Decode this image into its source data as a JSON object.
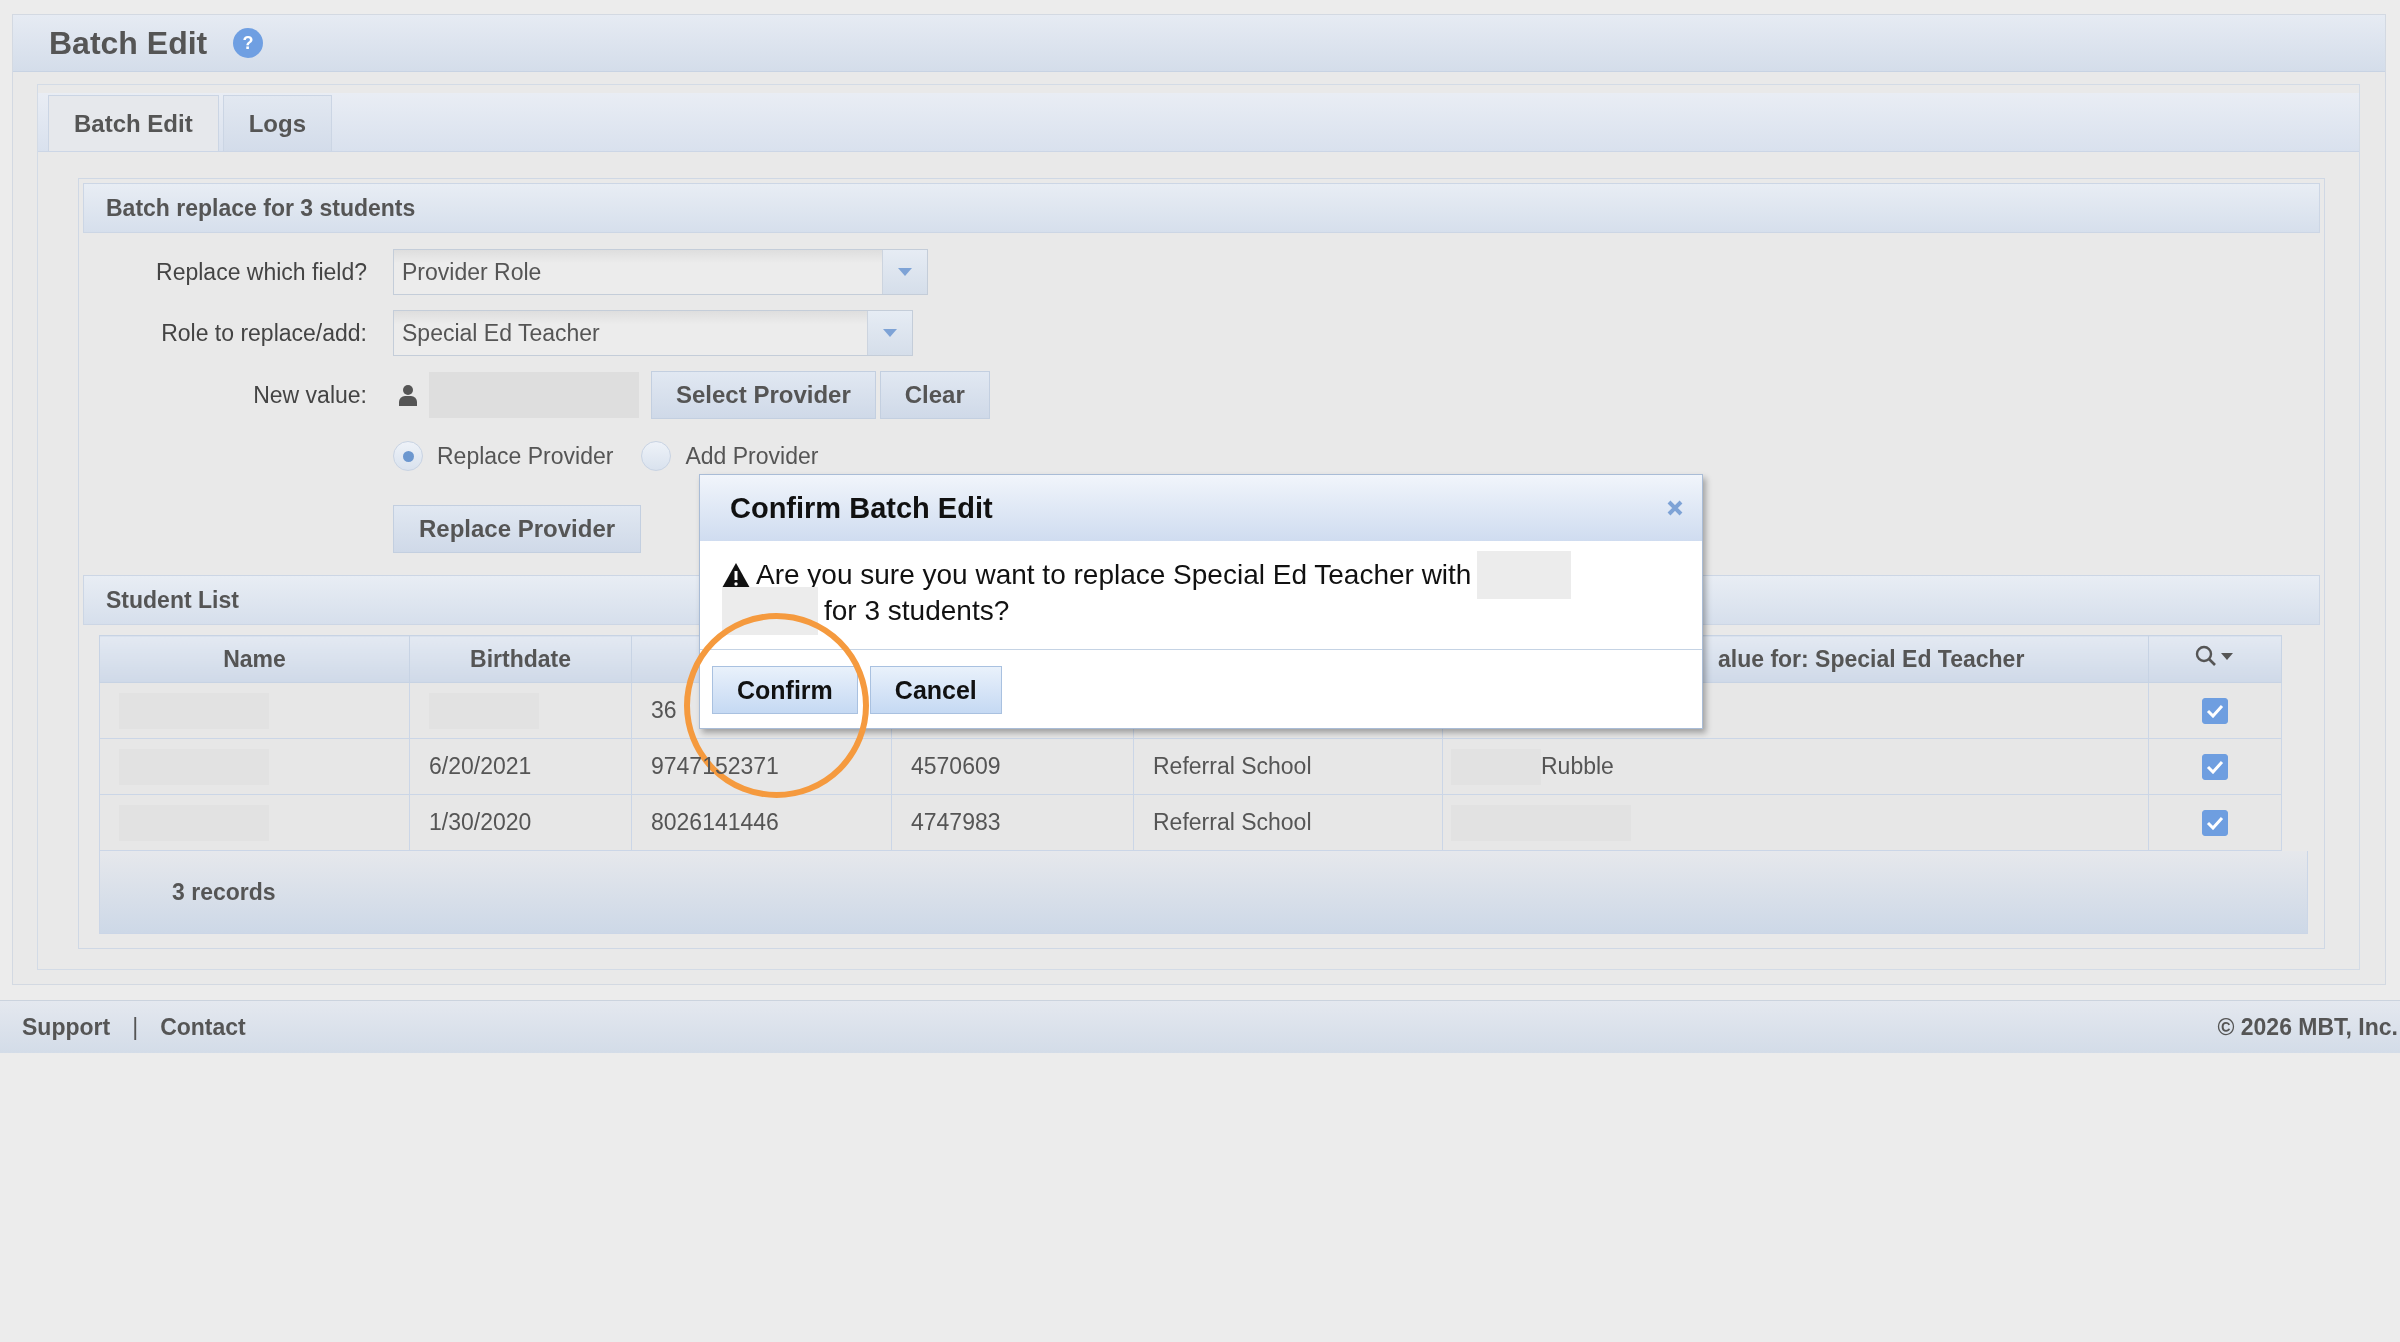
{
  "page_title": "Batch Edit",
  "help_icon": "?",
  "tabs": [
    {
      "label": "Batch Edit",
      "selected": true
    },
    {
      "label": "Logs",
      "selected": false
    }
  ],
  "batch_section": {
    "title": "Batch replace for 3 students",
    "fields": [
      {
        "label": "Replace which field?",
        "value": "Provider Role"
      },
      {
        "label": "Role to replace/add:",
        "value": "Special Ed Teacher"
      }
    ],
    "new_value_label": "New value:",
    "buttons": [
      "Select Provider",
      "Clear"
    ],
    "modes": [
      {
        "label": "Replace Provider",
        "selected": true
      },
      {
        "label": "Add Provider",
        "selected": false
      }
    ],
    "submit": "Replace Provider"
  },
  "student_list": {
    "title": "Student List",
    "columns": {
      "column_1": "Name",
      "column_2": "Birthdate",
      "column_6": "alue for: Special Ed Teacher"
    },
    "rows": [
      {
        "column_3": "36",
        "checked": true
      },
      {
        "birthdate": "6/20/2021",
        "column_3": "9747152371",
        "column_4": "4570609",
        "column_5": "Referral School",
        "column_6": "Rubble",
        "checked": true
      },
      {
        "birthdate": "1/30/2020",
        "column_3": "8026141446",
        "column_4": "4747983",
        "column_5": "Referral School",
        "checked": true
      }
    ],
    "record_count": "3 records"
  },
  "dialog": {
    "title": "Confirm Batch Edit",
    "message_start": "Are you sure you want to replace Special Ed Teacher with",
    "message_end": "for 3 students?",
    "buttons": [
      "Confirm",
      "Cancel"
    ]
  },
  "footer": {
    "links": [
      "Support",
      "Contact"
    ],
    "separator": "|",
    "copyright": "© 2026 MBT, Inc."
  }
}
